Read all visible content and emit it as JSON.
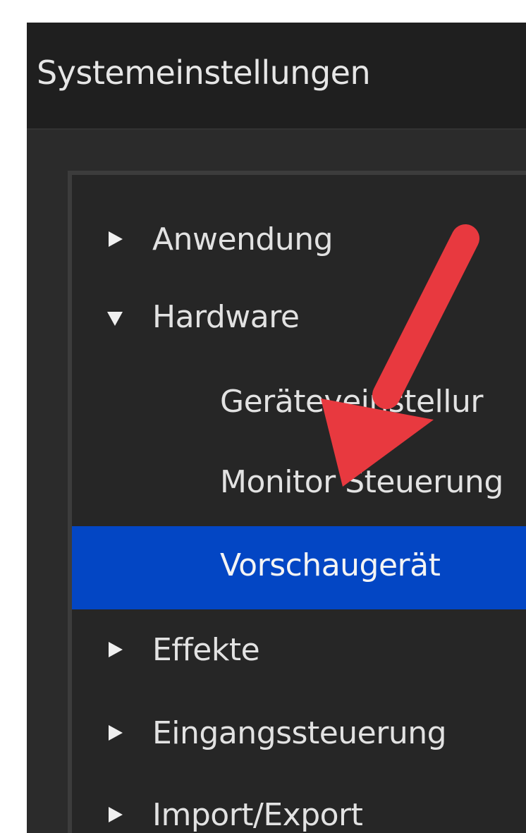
{
  "window": {
    "title": "Systemeinstellungen"
  },
  "tree": {
    "items": [
      {
        "label": "Anwendung",
        "level": 1,
        "expander": "collapsed",
        "selected": false
      },
      {
        "label": "Hardware",
        "level": 1,
        "expander": "expanded",
        "selected": false
      },
      {
        "label": "Geräteveinstellur",
        "level": 2,
        "expander": "none",
        "selected": false
      },
      {
        "label": "Monitor Steuerung",
        "level": 2,
        "expander": "none",
        "selected": false
      },
      {
        "label": "Vorschaugerät",
        "level": 2,
        "expander": "none",
        "selected": true
      },
      {
        "label": "Effekte",
        "level": 1,
        "expander": "collapsed",
        "selected": false
      },
      {
        "label": "Eingangssteuerung",
        "level": 1,
        "expander": "collapsed",
        "selected": false
      },
      {
        "label": "Import/Export",
        "level": 1,
        "expander": "collapsed",
        "selected": false
      }
    ]
  },
  "colors": {
    "window_bg": "#2b2b2b",
    "titlebar_bg": "#1f1f1f",
    "selection": "#0346c4",
    "annotation_arrow": "#e8393f",
    "text": "#e2e2e2"
  },
  "icons": {
    "collapsed": "triangle-right-icon",
    "expanded": "triangle-down-icon",
    "annotation": "red-pointer-arrow"
  }
}
